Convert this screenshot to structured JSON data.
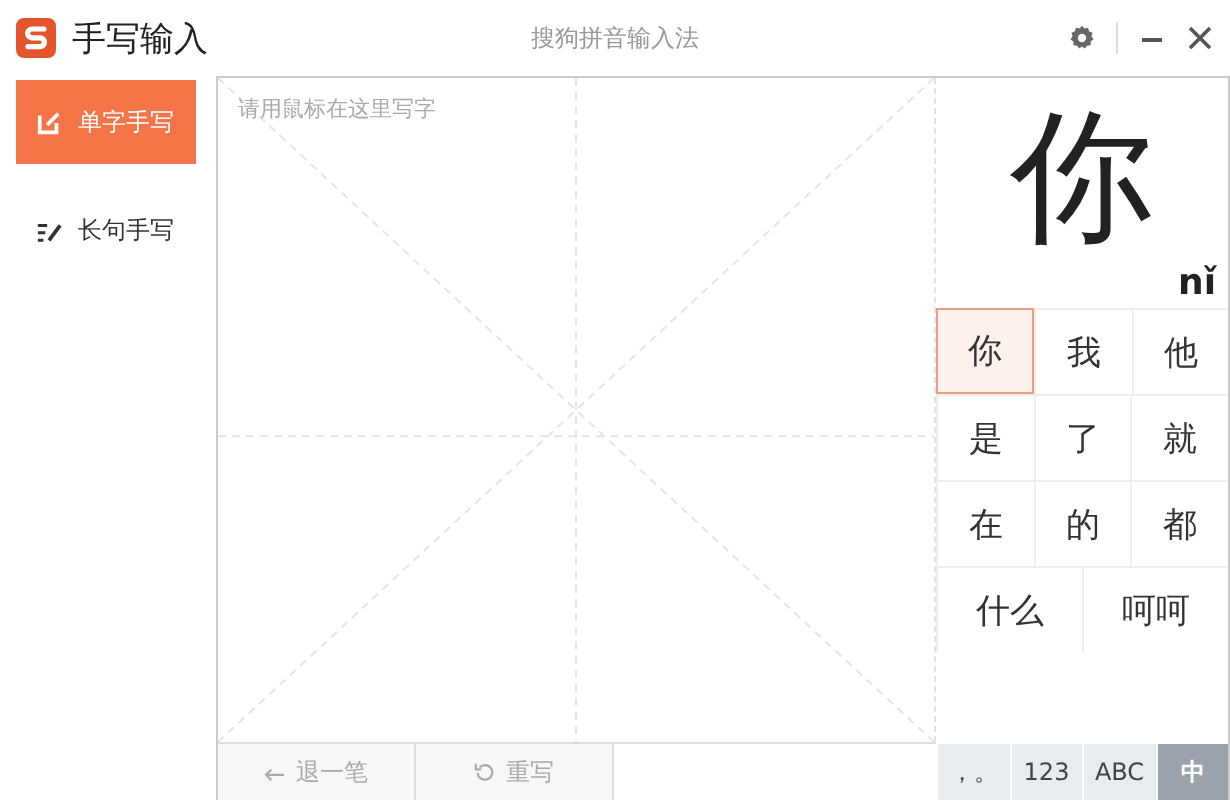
{
  "window": {
    "app_name": "手写输入",
    "title": "搜狗拼音输入法"
  },
  "sidebar": {
    "items": [
      {
        "label": "单字手写",
        "kind": "single",
        "selected": true
      },
      {
        "label": "长句手写",
        "kind": "sentence",
        "selected": false
      }
    ]
  },
  "canvas": {
    "placeholder": "请用鼠标在这里写字",
    "buttons": [
      {
        "label": "退一笔",
        "kind": "undo"
      },
      {
        "label": "重写",
        "kind": "redo"
      }
    ]
  },
  "preview": {
    "character": "你",
    "pinyin": "nǐ"
  },
  "candidates": [
    [
      {
        "text": "你",
        "selected": true
      },
      {
        "text": "我",
        "selected": false
      },
      {
        "text": "他",
        "selected": false
      }
    ],
    [
      {
        "text": "是",
        "selected": false
      },
      {
        "text": "了",
        "selected": false
      },
      {
        "text": "就",
        "selected": false
      }
    ],
    [
      {
        "text": "在",
        "selected": false
      },
      {
        "text": "的",
        "selected": false
      },
      {
        "text": "都",
        "selected": false
      }
    ],
    [
      {
        "text": "什么",
        "selected": false
      },
      {
        "text": "呵呵",
        "selected": false
      }
    ]
  ],
  "modes": [
    {
      "label": "，。",
      "selected": false
    },
    {
      "label": "123",
      "selected": false
    },
    {
      "label": "ABC",
      "selected": false
    },
    {
      "label": "中",
      "selected": true
    }
  ]
}
